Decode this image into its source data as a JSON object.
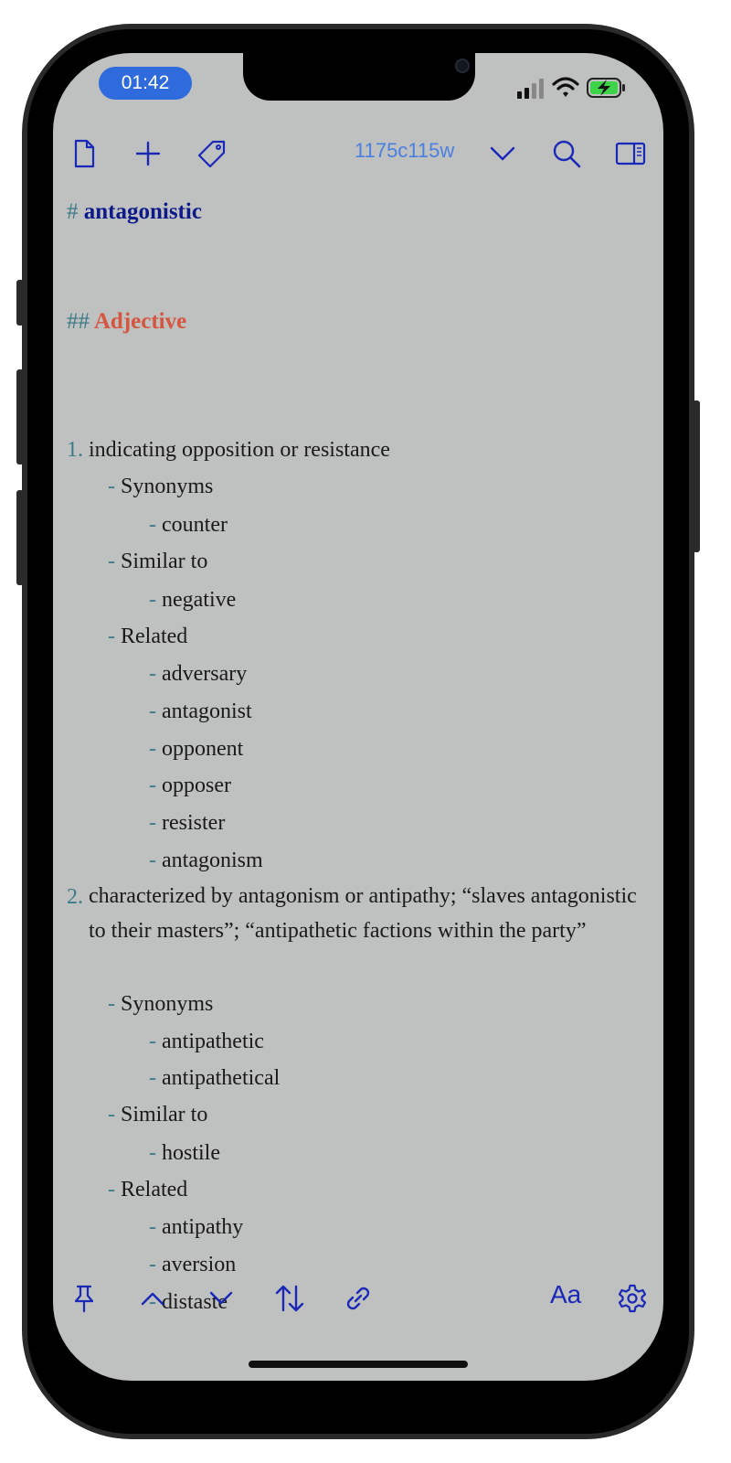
{
  "status_bar": {
    "time": "01:42",
    "battery_color": "#3dd44a"
  },
  "toolbar": {
    "count": "1175c115w"
  },
  "document": {
    "h1_marker": "#",
    "h1": "antagonistic",
    "h2_marker": "##",
    "h2": "Adjective",
    "sense1": {
      "num": "1.",
      "definition": "indicating opposition or resistance",
      "syn_label": "Synonyms",
      "syn": [
        "counter"
      ],
      "sim_label": "Similar to",
      "sim": [
        "negative"
      ],
      "rel_label": "Related",
      "rel": [
        "adversary",
        "antagonist",
        "opponent",
        "opposer",
        "resister",
        "antagonism"
      ]
    },
    "sense2": {
      "num": "2.",
      "definition": "characterized by antagonism or antipathy; “slaves antagonistic to their masters”; “antipathetic factions within the party”",
      "syn_label": "Synonyms",
      "syn": [
        "antipathetic",
        "antipathetical"
      ],
      "sim_label": "Similar to",
      "sim": [
        "hostile"
      ],
      "rel_label": "Related",
      "rel": [
        "antipathy",
        "aversion",
        "distaste"
      ]
    }
  },
  "bottom_toolbar": {
    "format_label": "Aa"
  },
  "colors": {
    "accent": "#1a28b8",
    "count": "#4a7fe0",
    "heading1": "#0d1a8a",
    "heading2": "#d5553f",
    "marker": "#3b7a86",
    "background": "#bfc0c0"
  }
}
